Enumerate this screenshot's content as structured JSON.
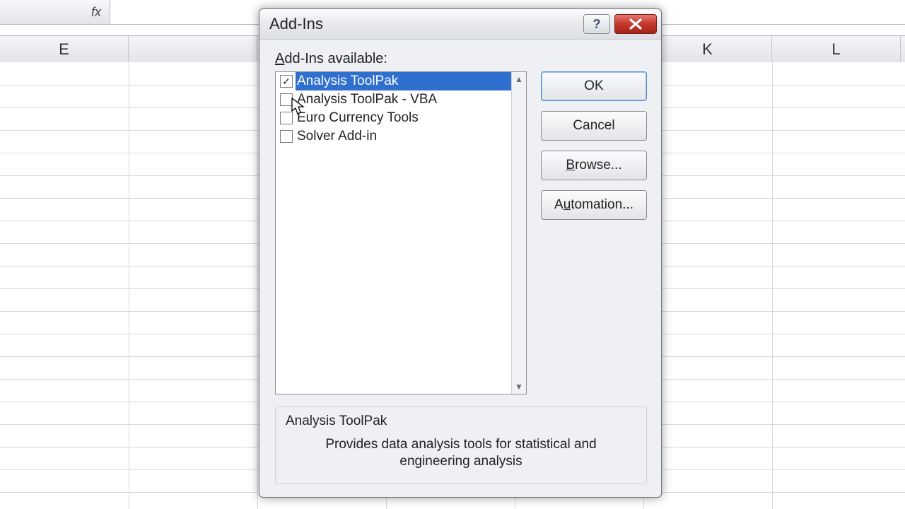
{
  "sheet": {
    "fx_label": "fx",
    "columns": [
      "E",
      "",
      "",
      "",
      "",
      "K",
      "L"
    ]
  },
  "dialog": {
    "title": "Add-Ins",
    "available_label_pre": "A",
    "available_label_post": "dd-Ins available:",
    "buttons": {
      "ok": "OK",
      "cancel": "Cancel",
      "browse_pre": "B",
      "browse_post": "rowse...",
      "automation_pre": "A",
      "automation_mid": "u",
      "automation_post": "tomation..."
    },
    "items": [
      {
        "label": "Analysis ToolPak",
        "checked": true,
        "selected": true
      },
      {
        "label": "Analysis ToolPak - VBA",
        "checked": false,
        "selected": false
      },
      {
        "label": "Euro Currency Tools",
        "checked": false,
        "selected": false
      },
      {
        "label": "Solver Add-in",
        "checked": false,
        "selected": false
      }
    ],
    "description": {
      "title": "Analysis ToolPak",
      "text": "Provides data analysis tools for statistical and engineering analysis"
    }
  }
}
